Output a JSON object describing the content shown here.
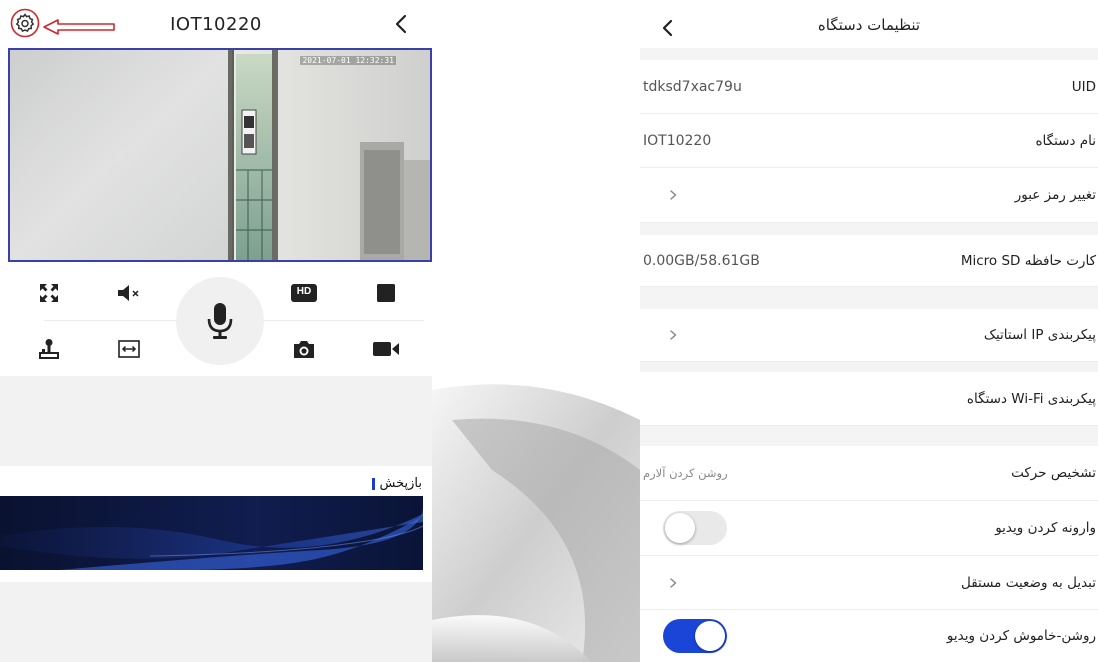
{
  "left": {
    "header": {
      "title": "IOT10220"
    },
    "video": {
      "timestamp": "2021-07-01 12:32:31"
    },
    "controls": {
      "hd_label": "HD",
      "icons": [
        "fullscreen-icon",
        "speaker-mute-icon",
        "hd-icon",
        "stop-icon",
        "joystick-icon",
        "stretch-icon",
        "camera-icon",
        "record-video-icon",
        "microphone-icon"
      ]
    },
    "playback": {
      "label": "بازپخش"
    }
  },
  "right": {
    "header": {
      "title": "تنظیمات دستگاه"
    },
    "rows": [
      {
        "label": "UID",
        "value": "tdksd7xac79u"
      },
      {
        "label": "نام دستگاه",
        "value": "IOT10220"
      },
      {
        "label": "تغییر رمز عبور"
      },
      {
        "label": "کارت حافظه Micro SD",
        "value": "0.00GB/58.61GB"
      },
      {
        "label": "پیکربندی IP استاتیک"
      },
      {
        "label": "پیکربندی Wi-Fi دستگاه"
      },
      {
        "label": "تشخیص حرکت",
        "hint": "روشن کردن آلارم"
      },
      {
        "label": "وارونه کردن ویدیو",
        "toggle": false
      },
      {
        "label": "تبدیل به وضعیت مستقل"
      },
      {
        "label": "روشن-خاموش کردن ویدیو",
        "toggle": true
      }
    ]
  },
  "colors": {
    "accent": "#1b45d6",
    "annotation": "#d0262b",
    "video_border": "#3b3fa8"
  }
}
